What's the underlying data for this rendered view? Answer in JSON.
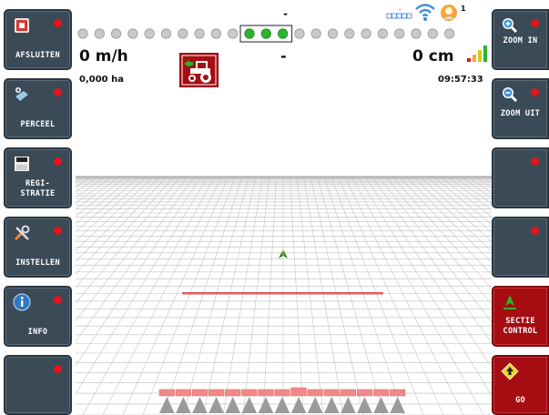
{
  "left_buttons": [
    {
      "id": "afsluiten",
      "label": "AFSLUITEN",
      "icon": "exit-icon"
    },
    {
      "id": "perceel",
      "label": "PERCEEL",
      "icon": "field-icon"
    },
    {
      "id": "registratie",
      "label": "REGI-\nSTRATIE",
      "icon": "disk-icon"
    },
    {
      "id": "instellen",
      "label": "INSTELLEN",
      "icon": "tools-icon"
    },
    {
      "id": "info",
      "label": "INFO",
      "icon": "info-icon"
    },
    {
      "id": "empty",
      "label": "",
      "icon": ""
    }
  ],
  "right_buttons": [
    {
      "id": "zoom-in",
      "label": "ZOOM IN",
      "icon": "zoom-in-icon"
    },
    {
      "id": "zoom-uit",
      "label": "ZOOM UIT",
      "icon": "zoom-out-icon"
    },
    {
      "id": "empty-1",
      "label": "",
      "icon": ""
    },
    {
      "id": "empty-2",
      "label": "",
      "icon": ""
    },
    {
      "id": "sectie-control",
      "label": "SECTIE\nCONTROL",
      "icon": "section-control-icon"
    },
    {
      "id": "go",
      "label": "GO",
      "icon": "go-icon"
    }
  ],
  "status": {
    "top_dash": "-",
    "speed": "0 m/h",
    "center_dash": "-",
    "offset": "0 cm",
    "area": "0,000 ha",
    "time": "09:57:33",
    "signal_dash": "-",
    "satellite_count": "1"
  },
  "lightbar": {
    "total_dots": 23,
    "active_center_dots": 3
  },
  "colors": {
    "accent_red": "#a50d12",
    "dot_red": "#e4141b",
    "active_green": "#2bb52b",
    "button_gray": "#3b4a57"
  }
}
